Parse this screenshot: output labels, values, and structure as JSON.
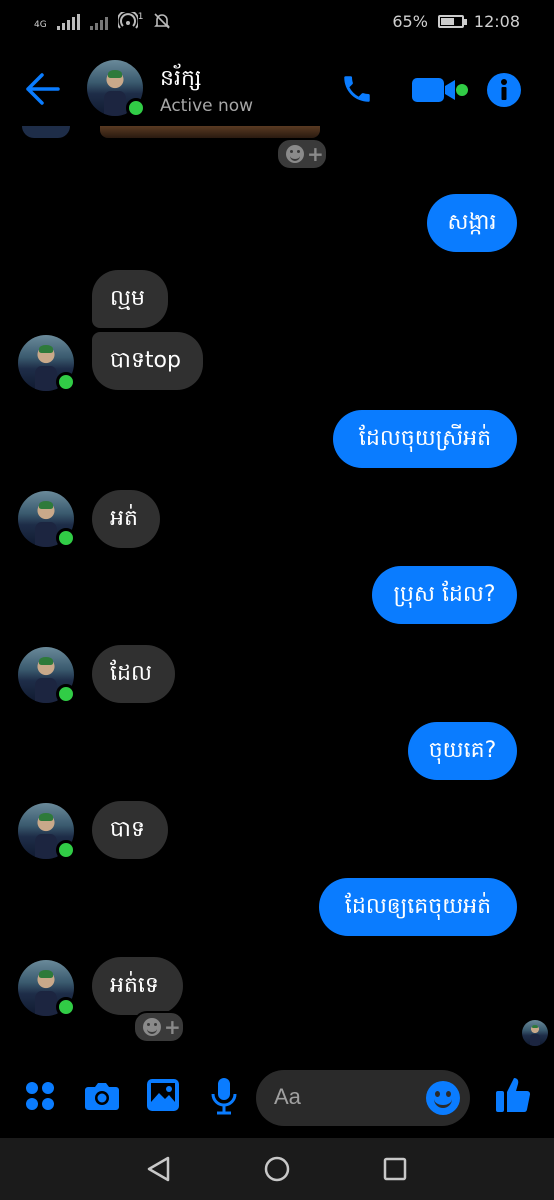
{
  "status_bar": {
    "network_label": "4G",
    "wifi_badge": "1",
    "battery": "65%",
    "battery_level": 0.65,
    "time": "12:08"
  },
  "header": {
    "contact_name": "នរ័ក្ស",
    "status": "Active now"
  },
  "messages": [
    {
      "sender": "me",
      "text": "សង្ការ"
    },
    {
      "sender": "contact",
      "text": "ល្មម"
    },
    {
      "sender": "contact",
      "text": "បាទtop"
    },
    {
      "sender": "me",
      "text": "ដែលចុយស្រីអត់"
    },
    {
      "sender": "contact",
      "text": "អត់"
    },
    {
      "sender": "me",
      "text": "ប្រុស ដែល?"
    },
    {
      "sender": "contact",
      "text": "ដែល"
    },
    {
      "sender": "me",
      "text": "ចុយគេ?"
    },
    {
      "sender": "contact",
      "text": "បាទ"
    },
    {
      "sender": "me",
      "text": "ដែលឲ្យគេចុយអត់"
    },
    {
      "sender": "contact",
      "text": "អត់ទេ"
    }
  ],
  "composer": {
    "placeholder": "Aa"
  },
  "colors": {
    "accent": "#0a7cff",
    "online": "#31cc46",
    "incoming_bubble": "#303030",
    "background": "#000000"
  },
  "icons": [
    "back-arrow-icon",
    "phone-icon",
    "video-camera-icon",
    "info-icon",
    "menu-dots-icon",
    "camera-icon",
    "gallery-icon",
    "microphone-icon",
    "emoji-icon",
    "thumbs-up-icon",
    "nav-back-icon",
    "nav-home-icon",
    "nav-recents-icon"
  ]
}
